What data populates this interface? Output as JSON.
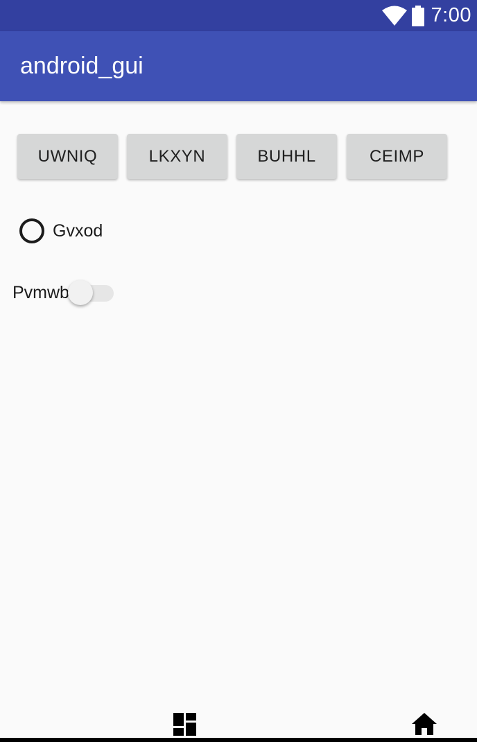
{
  "status_bar": {
    "time": "7:00",
    "wifi_icon": "wifi-icon",
    "battery_icon": "battery-icon"
  },
  "app_bar": {
    "title": "android_gui"
  },
  "buttons": [
    {
      "label": "UWNIQ"
    },
    {
      "label": "LKXYN"
    },
    {
      "label": "BUHHL"
    },
    {
      "label": "CEIMP"
    }
  ],
  "radio": {
    "label": "Gvxod",
    "checked": false
  },
  "switch": {
    "label": "Pvmwb",
    "on": false
  },
  "bottom_nav": {
    "left_icon": "dashboard-icon",
    "right_icon": "home-icon"
  },
  "colors": {
    "status_bar": "#3340a0",
    "app_bar": "#3f51b5",
    "background": "#fafafa",
    "button": "#d6d7d7"
  }
}
